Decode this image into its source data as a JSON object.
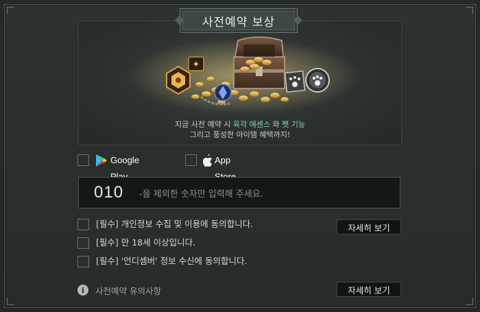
{
  "header": {
    "title": "사전예약 보상"
  },
  "banner": {
    "line1_prefix": "지금 사전 예약 시 ",
    "line1_highlight1": "육각 에센스",
    "line1_mid": " 와 ",
    "line1_highlight2": "펫 기능",
    "line2": "그리고 풍성한 아이템 혜택까지!"
  },
  "stores": [
    {
      "label": "Google Play",
      "icon": "google-play-icon"
    },
    {
      "label": "App Store",
      "icon": "apple-icon"
    }
  ],
  "phone": {
    "prefix": "010",
    "placeholder": "-을 제외한 숫자만 입력해 주세요."
  },
  "agreements": [
    {
      "label": "[필수] 개인정보 수집 및 이용에 동의합니다."
    },
    {
      "label": "[필수] 만 18세 이상입니다."
    },
    {
      "label": "[필수] '언디셈버' 정보 수신에 동의합니다."
    }
  ],
  "detail_button_label": "자세히 보기",
  "notice": {
    "label": "사전예약 유의사항",
    "icon": "info-icon"
  },
  "colors": {
    "background": "#232927",
    "highlight": "#7fd8b4",
    "gold": "#d9a53a"
  }
}
